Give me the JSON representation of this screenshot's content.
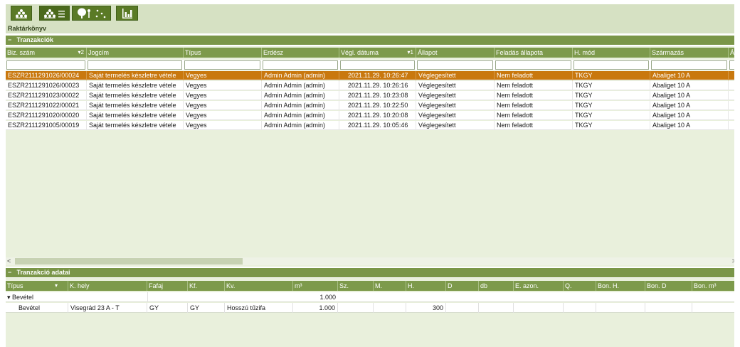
{
  "toolbar": {
    "buttons": [
      {
        "name": "warehouse-icon"
      },
      {
        "name": "warehouse-list-icon"
      },
      {
        "name": "forest-icon"
      },
      {
        "name": "chart-icon"
      }
    ]
  },
  "app": {
    "title": "Raktárkönyv"
  },
  "transactions": {
    "panel_title": "Tranzakciók",
    "collapse_symbol": "−",
    "columns": [
      {
        "label": "Biz. szám",
        "sort": "▾2"
      },
      {
        "label": "Jogcím",
        "sort": ""
      },
      {
        "label": "Típus",
        "sort": ""
      },
      {
        "label": "Erdész",
        "sort": ""
      },
      {
        "label": "Végl. dátuma",
        "sort": "▾1"
      },
      {
        "label": "Állapot",
        "sort": ""
      },
      {
        "label": "Feladás állapota",
        "sort": ""
      },
      {
        "label": "H. mód",
        "sort": ""
      },
      {
        "label": "Származás",
        "sort": ""
      },
      {
        "label": "Átr",
        "sort": ""
      }
    ],
    "rows": [
      {
        "biz": "ESZR2111291026/00024",
        "jogcim": "Saját termelés készletre vétele",
        "tipus": "Vegyes",
        "erdesz": "Admin Admin (admin)",
        "datum": "2021.11.29. 10:26:47",
        "allapot": "Véglegesített",
        "feladas": "Nem feladott",
        "hmod": "TKGY",
        "szarmazas": "Abaliget 10 A",
        "selected": true
      },
      {
        "biz": "ESZR2111291026/00023",
        "jogcim": "Saját termelés készletre vétele",
        "tipus": "Vegyes",
        "erdesz": "Admin Admin (admin)",
        "datum": "2021.11.29. 10:26:16",
        "allapot": "Véglegesített",
        "feladas": "Nem feladott",
        "hmod": "TKGY",
        "szarmazas": "Abaliget 10 A",
        "selected": false
      },
      {
        "biz": "ESZR2111291023/00022",
        "jogcim": "Saját termelés készletre vétele",
        "tipus": "Vegyes",
        "erdesz": "Admin Admin (admin)",
        "datum": "2021.11.29. 10:23:08",
        "allapot": "Véglegesített",
        "feladas": "Nem feladott",
        "hmod": "TKGY",
        "szarmazas": "Abaliget 10 A",
        "selected": false
      },
      {
        "biz": "ESZR2111291022/00021",
        "jogcim": "Saját termelés készletre vétele",
        "tipus": "Vegyes",
        "erdesz": "Admin Admin (admin)",
        "datum": "2021.11.29. 10:22:50",
        "allapot": "Véglegesített",
        "feladas": "Nem feladott",
        "hmod": "TKGY",
        "szarmazas": "Abaliget 10 A",
        "selected": false
      },
      {
        "biz": "ESZR2111291020/00020",
        "jogcim": "Saját termelés készletre vétele",
        "tipus": "Vegyes",
        "erdesz": "Admin Admin (admin)",
        "datum": "2021.11.29. 10:20:08",
        "allapot": "Véglegesített",
        "feladas": "Nem feladott",
        "hmod": "TKGY",
        "szarmazas": "Abaliget 10 A",
        "selected": false
      },
      {
        "biz": "ESZR2111291005/00019",
        "jogcim": "Saját termelés készletre vétele",
        "tipus": "Vegyes",
        "erdesz": "Admin Admin (admin)",
        "datum": "2021.11.29. 10:05:46",
        "allapot": "Véglegesített",
        "feladas": "Nem feladott",
        "hmod": "TKGY",
        "szarmazas": "Abaliget 10 A",
        "selected": false
      }
    ],
    "scroll_left": "<",
    "scroll_right": ">"
  },
  "details": {
    "panel_title": "Tranzakció adatai",
    "collapse_symbol": "−",
    "columns": [
      "Típus",
      "K. hely",
      "Fafaj",
      "Kf.",
      "Kv.",
      "m³",
      "Sz.",
      "M.",
      "H.",
      "D",
      "db",
      "E. azon.",
      "Q.",
      "Bon. H.",
      "Bon. D",
      "Bon. m³"
    ],
    "tipus_sort": "▾",
    "group": {
      "expander": "▾",
      "label": "Bevétel",
      "m3": "1.000"
    },
    "items": [
      {
        "tipus": "Bevétel",
        "khely": "Visegrád 23 A - T",
        "fafaj": "GY",
        "kf": "GY",
        "kv": "Hosszú tűzifa",
        "m3": "1.000",
        "sz": "",
        "m": "",
        "h": "300",
        "d": "",
        "db": "",
        "eazon": "",
        "q": "",
        "bonh": "",
        "bond": "",
        "bonm3": ""
      }
    ]
  }
}
